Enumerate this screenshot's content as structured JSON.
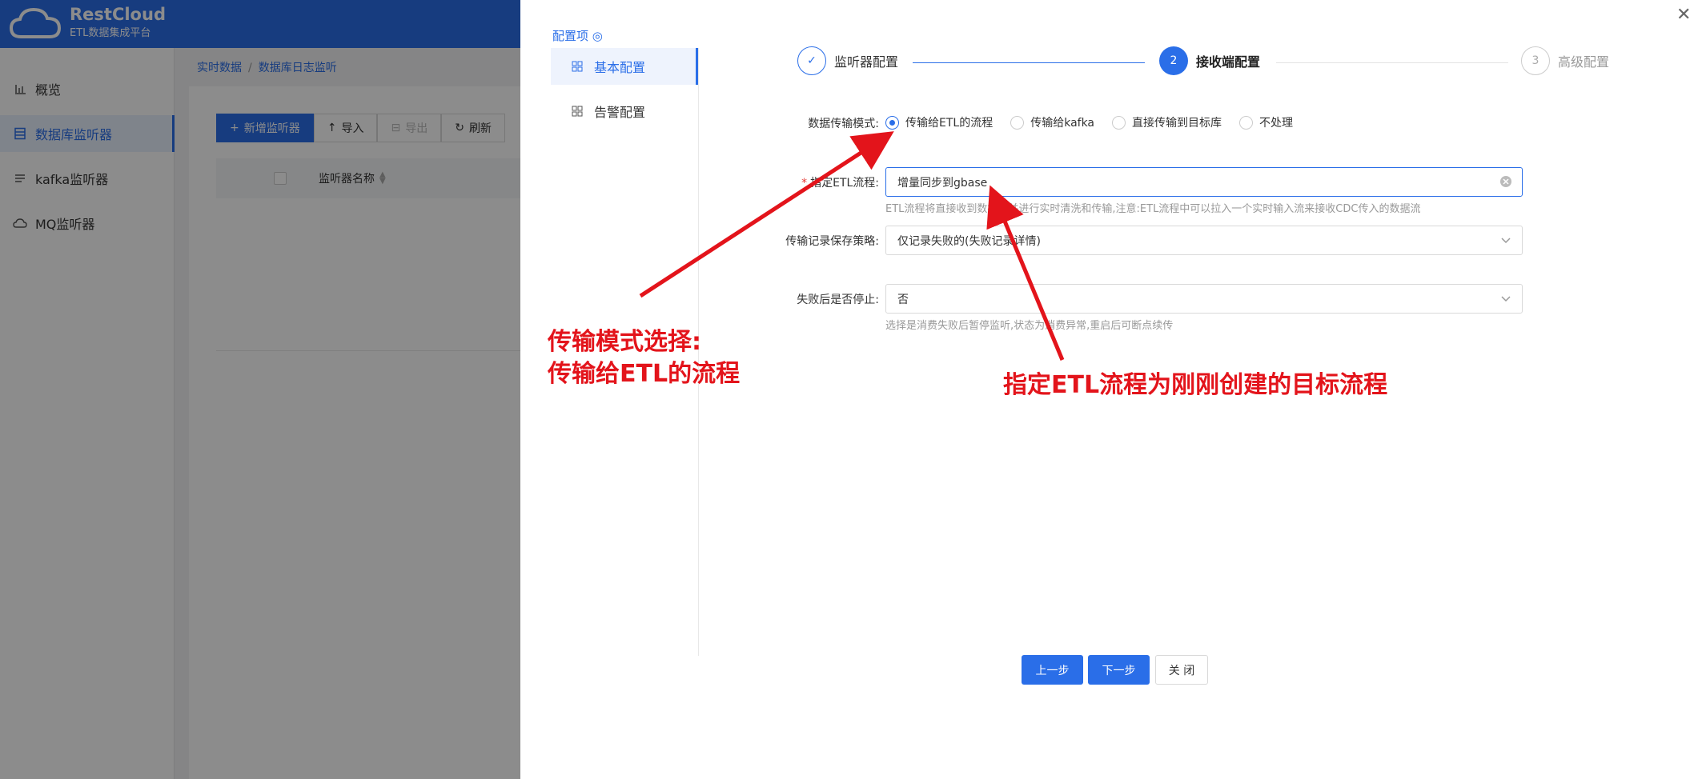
{
  "logo": {
    "name": "RestCloud",
    "subtitle": "ETL数据集成平台"
  },
  "sidebar": {
    "items": [
      {
        "label": "概览",
        "icon": "bar-chart-icon"
      },
      {
        "label": "数据库监听器",
        "icon": "list-icon",
        "active": true
      },
      {
        "label": "kafka监听器",
        "icon": "stack-icon"
      },
      {
        "label": "MQ监听器",
        "icon": "cloud-icon"
      }
    ]
  },
  "breadcrumb": {
    "root": "实时数据",
    "current": "数据库日志监听"
  },
  "toolbar": {
    "add": "新增监听器",
    "import": "导入",
    "export": "导出",
    "refresh": "刷新"
  },
  "table": {
    "header_name": "监听器名称"
  },
  "drawer": {
    "config_title": "配置项",
    "nav": [
      {
        "label": "基本配置",
        "active": true
      },
      {
        "label": "告警配置"
      }
    ],
    "steps": [
      {
        "label": "监听器配置",
        "status": "done"
      },
      {
        "num": "2",
        "label": "接收端配置",
        "status": "current"
      },
      {
        "num": "3",
        "label": "高级配置",
        "status": "todo"
      }
    ],
    "form": {
      "mode_label": "数据传输模式:",
      "mode_options": [
        "传输给ETL的流程",
        "传输给kafka",
        "直接传输到目标库",
        "不处理"
      ],
      "mode_selected": "传输给ETL的流程",
      "flow_label": "指定ETL流程:",
      "flow_value": "增量同步到gbase",
      "flow_hint": "ETL流程将直接收到数据流并进行实时清洗和传输,注意:ETL流程中可以拉入一个实时输入流来接收CDC传入的数据流",
      "save_label": "传输记录保存策略:",
      "save_value": "仅记录失败的(失败记录详情)",
      "stop_label": "失败后是否停止:",
      "stop_value": "否",
      "stop_hint": "选择是消费失败后暂停监听,状态为消费异常,重启后可断点续传"
    },
    "buttons": {
      "prev": "上一步",
      "next": "下一步",
      "close": "关 闭"
    }
  },
  "annotations": {
    "left_line1": "传输模式选择:",
    "left_line2": "传输给ETL的流程",
    "right": "指定ETL流程为刚刚创建的目标流程"
  },
  "colors": {
    "primary": "#2a6ee8",
    "annotation": "#e3141b"
  }
}
